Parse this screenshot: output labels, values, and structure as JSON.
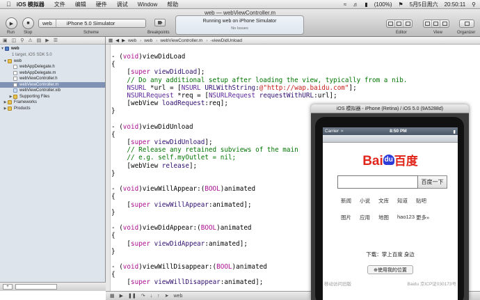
{
  "menubar": {
    "apple": "",
    "app": "iOS 模拟器",
    "items": [
      "文件",
      "编辑",
      "硬件",
      "调试",
      "Window",
      "帮助"
    ],
    "battery": "(100%)",
    "date": "5月5日周六",
    "time": "20:50:11"
  },
  "toolbar": {
    "window_title": "web — webViewController.m",
    "run_label": "Run",
    "stop_label": "Stop",
    "scheme_project": "web",
    "scheme_target": "iPhone 5.0 Simulator",
    "scheme_label": "Scheme",
    "breakpoints_label": "Breakpoints",
    "activity_text": "Running web on iPhone Simulator",
    "activity_issues": "No Issues",
    "editor_label": "Editor",
    "view_label": "View",
    "organizer_label": "Organizer"
  },
  "navigator": {
    "project_name": "web",
    "project_sub": "1 target, iOS SDK 5.0",
    "items": [
      {
        "label": "web",
        "type": "folder",
        "indent": 1,
        "expanded": true
      },
      {
        "label": "webAppDelegate.h",
        "type": "h",
        "indent": 2
      },
      {
        "label": "webAppDelegate.m",
        "type": "m",
        "indent": 2
      },
      {
        "label": "webViewController.h",
        "type": "h",
        "indent": 2
      },
      {
        "label": "webViewController.m",
        "type": "m",
        "indent": 2,
        "selected": true
      },
      {
        "label": "webViewController.xib",
        "type": "xib",
        "indent": 2
      },
      {
        "label": "Supporting Files",
        "type": "folder",
        "indent": 2,
        "expanded": false
      },
      {
        "label": "Frameworks",
        "type": "folder",
        "indent": 1,
        "expanded": false
      },
      {
        "label": "Products",
        "type": "folder",
        "indent": 1,
        "expanded": false
      }
    ]
  },
  "jumpbar": {
    "crumbs": [
      "web",
      "web",
      "webViewController.m",
      "-viewDidUnload"
    ]
  },
  "editor": {
    "lines": [
      [
        [
          "- (",
          ""
        ],
        [
          "void",
          "kw"
        ],
        [
          ")viewDidLoad",
          ""
        ]
      ],
      [
        [
          "{",
          ""
        ]
      ],
      [
        [
          "    [",
          ""
        ],
        [
          "super",
          "kw"
        ],
        [
          " ",
          ""
        ],
        [
          "viewDidLoad",
          "meth"
        ],
        [
          "];",
          ""
        ]
      ],
      [
        [
          "    ",
          ""
        ],
        [
          "// Do any additional setup after loading the view, typically from a nib.",
          "cm"
        ]
      ],
      [
        [
          "    ",
          ""
        ],
        [
          "NSURL",
          "cls"
        ],
        [
          " *url = [",
          ""
        ],
        [
          "NSURL",
          "cls"
        ],
        [
          " ",
          ""
        ],
        [
          "URLWithString",
          "meth"
        ],
        [
          ":",
          ""
        ],
        [
          "@\"http://wap.baidu.com\"",
          "str"
        ],
        [
          "];",
          ""
        ]
      ],
      [
        [
          "    ",
          ""
        ],
        [
          "NSURLRequest",
          "cls"
        ],
        [
          " *req = [",
          ""
        ],
        [
          "NSURLRequest",
          "cls"
        ],
        [
          " ",
          ""
        ],
        [
          "requestWithURL",
          "meth"
        ],
        [
          ":url];",
          ""
        ]
      ],
      [
        [
          "    [webView ",
          ""
        ],
        [
          "loadRequest",
          "meth"
        ],
        [
          ":req];",
          ""
        ]
      ],
      [
        [
          "}",
          ""
        ]
      ],
      [
        [
          "",
          ""
        ]
      ],
      [
        [
          "- (",
          ""
        ],
        [
          "void",
          "kw"
        ],
        [
          ")viewDidUnload",
          ""
        ]
      ],
      [
        [
          "{",
          ""
        ]
      ],
      [
        [
          "    [",
          ""
        ],
        [
          "super",
          "kw"
        ],
        [
          " ",
          ""
        ],
        [
          "viewDidUnload",
          "meth"
        ],
        [
          "];",
          ""
        ]
      ],
      [
        [
          "    ",
          ""
        ],
        [
          "// Release any retained subviews of the main",
          "cm"
        ]
      ],
      [
        [
          "    ",
          ""
        ],
        [
          "// e.g. self.myOutlet = nil;",
          "cm"
        ]
      ],
      [
        [
          "    [webView ",
          ""
        ],
        [
          "release",
          "meth"
        ],
        [
          "];",
          ""
        ]
      ],
      [
        [
          "}",
          ""
        ]
      ],
      [
        [
          "",
          ""
        ]
      ],
      [
        [
          "- (",
          ""
        ],
        [
          "void",
          "kw"
        ],
        [
          ")viewWillAppear:(",
          ""
        ],
        [
          "BOOL",
          "kw"
        ],
        [
          ")animated",
          ""
        ]
      ],
      [
        [
          "{",
          ""
        ]
      ],
      [
        [
          "    [",
          ""
        ],
        [
          "super",
          "kw"
        ],
        [
          " ",
          ""
        ],
        [
          "viewWillAppear",
          "meth"
        ],
        [
          ":animated];",
          ""
        ]
      ],
      [
        [
          "}",
          ""
        ]
      ],
      [
        [
          "",
          ""
        ]
      ],
      [
        [
          "- (",
          ""
        ],
        [
          "void",
          "kw"
        ],
        [
          ")viewDidAppear:(",
          ""
        ],
        [
          "BOOL",
          "kw"
        ],
        [
          ")animated",
          ""
        ]
      ],
      [
        [
          "{",
          ""
        ]
      ],
      [
        [
          "    [",
          ""
        ],
        [
          "super",
          "kw"
        ],
        [
          " ",
          ""
        ],
        [
          "viewDidAppear",
          "meth"
        ],
        [
          ":animated];",
          ""
        ]
      ],
      [
        [
          "}",
          ""
        ]
      ],
      [
        [
          "",
          ""
        ]
      ],
      [
        [
          "- (",
          ""
        ],
        [
          "void",
          "kw"
        ],
        [
          ")viewWillDisappear:(",
          ""
        ],
        [
          "BOOL",
          "kw"
        ],
        [
          ")animated",
          ""
        ]
      ],
      [
        [
          "{",
          ""
        ]
      ],
      [
        [
          "    [",
          ""
        ],
        [
          "super",
          "kw"
        ],
        [
          " ",
          ""
        ],
        [
          "viewWillDisappear",
          "meth"
        ],
        [
          ":animated];",
          ""
        ]
      ]
    ]
  },
  "debugbar": {
    "target": "web"
  },
  "simulator": {
    "title": "iOS 模拟器 - iPhone (Retina) / iOS 5.0 (9A5288d)",
    "carrier": "Carrier",
    "time": "8:50 PM",
    "logo_bai": "Bai",
    "logo_du": "du",
    "logo_cn": "百度",
    "search_placeholder": "",
    "search_button": "百度一下",
    "row1": [
      "新闻",
      "小说",
      "文库",
      "知道",
      "贴吧"
    ],
    "row2": [
      "图片",
      "应用",
      "地图",
      "hao123",
      "更多»"
    ],
    "download": "下载：掌上百度 身边",
    "location_button": "⊕使用我的位置",
    "footer_left": "移动访问旧版",
    "footer_right": "Baidu 京ICP证030173号"
  }
}
